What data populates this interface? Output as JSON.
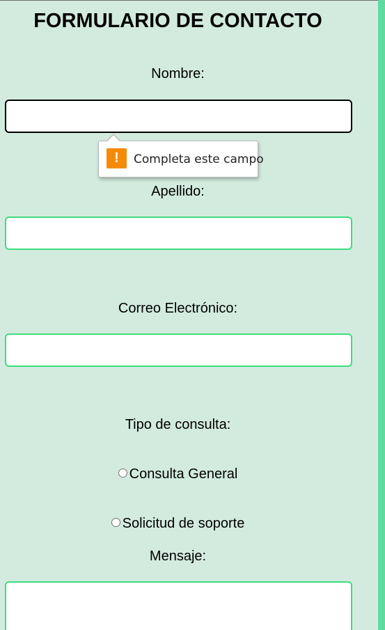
{
  "form": {
    "title": "FORMULARIO DE CONTACTO",
    "nombre_label": "Nombre:",
    "nombre_value": "",
    "apellido_label": "Apellido:",
    "apellido_value": "",
    "correo_label": "Correo Electrónico:",
    "correo_value": "",
    "tipo_label": "Tipo de consulta:",
    "radio_options": [
      {
        "label": "Consulta General",
        "checked": false
      },
      {
        "label": "Solicitud de soporte",
        "checked": false
      }
    ],
    "mensaje_label": "Mensaje:",
    "mensaje_value": ""
  },
  "validation_tooltip": {
    "icon": "warning-icon",
    "icon_glyph": "!",
    "text": "Completa este campo"
  },
  "colors": {
    "background": "#d3ebdf",
    "accent_border": "#3ddd7b",
    "right_bar": "#5fdba0",
    "warning": "#f58a07"
  }
}
